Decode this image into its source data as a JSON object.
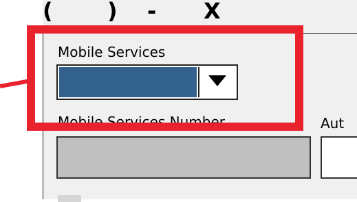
{
  "phone_field": {
    "open_paren": "(",
    "close_paren": ")",
    "dash": "-",
    "extension_mark": "X"
  },
  "mobile_services": {
    "label": "Mobile Services",
    "selected_value": ""
  },
  "mobile_number": {
    "label": "Mobile Services Number",
    "value": ""
  },
  "auto_field": {
    "label": "Aut",
    "value": ""
  },
  "icons": {
    "dropdown_arrow": "chevron-down-icon"
  },
  "colors": {
    "highlight": "#e8232d",
    "selected_fill": "#34628f",
    "disabled_fill": "#c0c0c0"
  }
}
